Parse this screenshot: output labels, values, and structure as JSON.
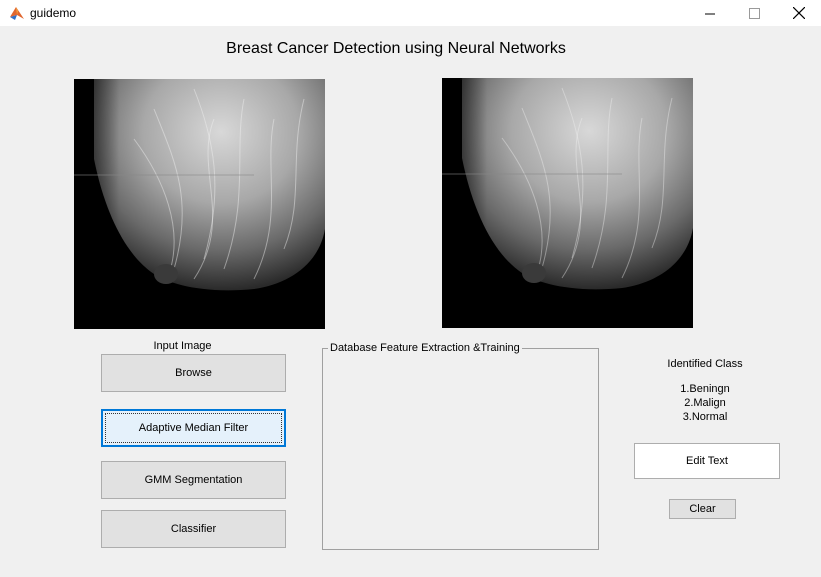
{
  "window": {
    "title": "guidemo",
    "icons": [
      "matlab-app-icon",
      "minimize-icon",
      "maximize-icon",
      "close-icon"
    ]
  },
  "heading": "Breast Cancer Detection using Neural Networks",
  "input_panel": {
    "label": "Input Image",
    "buttons": {
      "browse": "Browse",
      "filter": "Adaptive Median Filter",
      "segmentation": "GMM Segmentation",
      "classifier": "Classifier"
    }
  },
  "database_panel": {
    "title": "Database Feature Extraction &Training"
  },
  "classes": {
    "heading": "Identified Class",
    "items": [
      "1.Beningn",
      "2.Malign",
      "3.Normal"
    ]
  },
  "edit_text": "Edit Text",
  "clear_button": "Clear",
  "colors": {
    "window_bg": "#f0f0f0",
    "button_bg": "#e1e1e1",
    "focus_blue": "#0078d7",
    "axes_bg": "#000000"
  }
}
